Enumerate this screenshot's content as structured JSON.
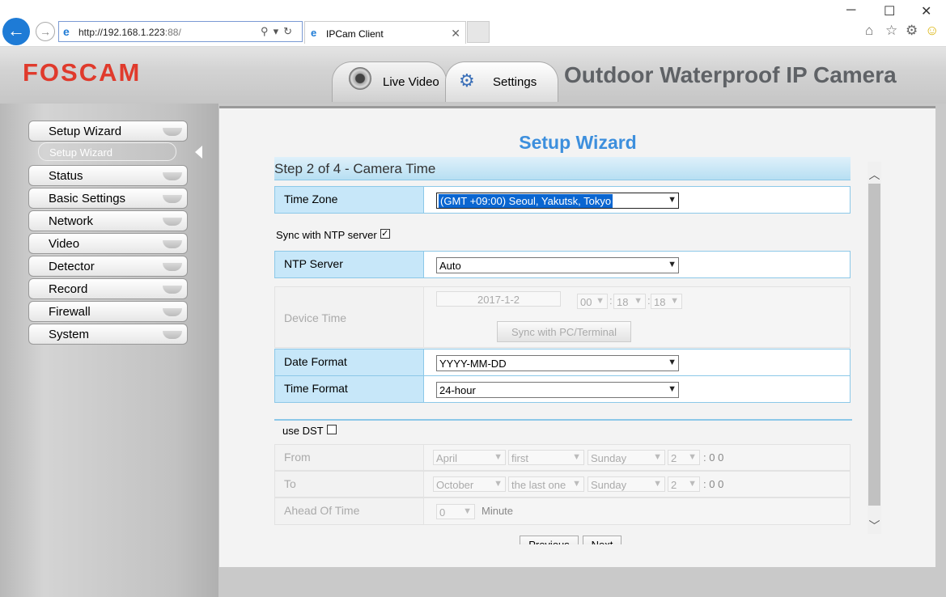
{
  "browser": {
    "url_host": "http://192.168.1.223",
    "url_port": ":88/",
    "tab_title": "IPCam Client",
    "window_controls": [
      "─",
      "☐",
      "✕"
    ],
    "right_icons": [
      "home-icon",
      "star-icon",
      "gear-icon",
      "smiley-icon"
    ]
  },
  "app": {
    "logo": "FOSCAM",
    "product": "Outdoor Waterproof IP Camera",
    "nav_tabs": [
      {
        "label": "Live Video",
        "icon": "camera-icon"
      },
      {
        "label": "Settings",
        "icon": "settings-icon"
      }
    ]
  },
  "sidebar": {
    "items": [
      {
        "label": "Setup Wizard"
      },
      {
        "label": "Status"
      },
      {
        "label": "Basic Settings"
      },
      {
        "label": "Network"
      },
      {
        "label": "Video"
      },
      {
        "label": "Detector"
      },
      {
        "label": "Record"
      },
      {
        "label": "Firewall"
      },
      {
        "label": "System"
      }
    ],
    "active_sub": "Setup Wizard"
  },
  "main": {
    "title": "Setup Wizard",
    "step": "Step 2 of 4 - Camera Time",
    "time_zone": {
      "label": "Time Zone",
      "value": "(GMT +09:00) Seoul, Yakutsk, Tokyo"
    },
    "sync_ntp": {
      "label": "Sync with NTP server",
      "checked": true
    },
    "ntp_server": {
      "label": "NTP Server",
      "value": "Auto"
    },
    "device_time": {
      "label": "Device Time",
      "date": "2017-1-2",
      "hour": "00",
      "minute": "18",
      "second": "18",
      "sep": ":",
      "sync_button": "Sync with PC/Terminal"
    },
    "date_format": {
      "label": "Date Format",
      "value": "YYYY-MM-DD"
    },
    "time_format": {
      "label": "Time Format",
      "value": "24-hour"
    },
    "use_dst": {
      "label": "use DST",
      "checked": false
    },
    "from": {
      "label": "From",
      "month": "April",
      "week": "first",
      "day": "Sunday",
      "hour": "2",
      "suffix": ": 0 0"
    },
    "to": {
      "label": "To",
      "month": "October",
      "week": "the last one",
      "day": "Sunday",
      "hour": "2",
      "suffix": ": 0 0"
    },
    "ahead": {
      "label": "Ahead Of Time",
      "value": "0",
      "unit": "Minute"
    },
    "previous_button": "Previous",
    "next_button": "Next"
  }
}
